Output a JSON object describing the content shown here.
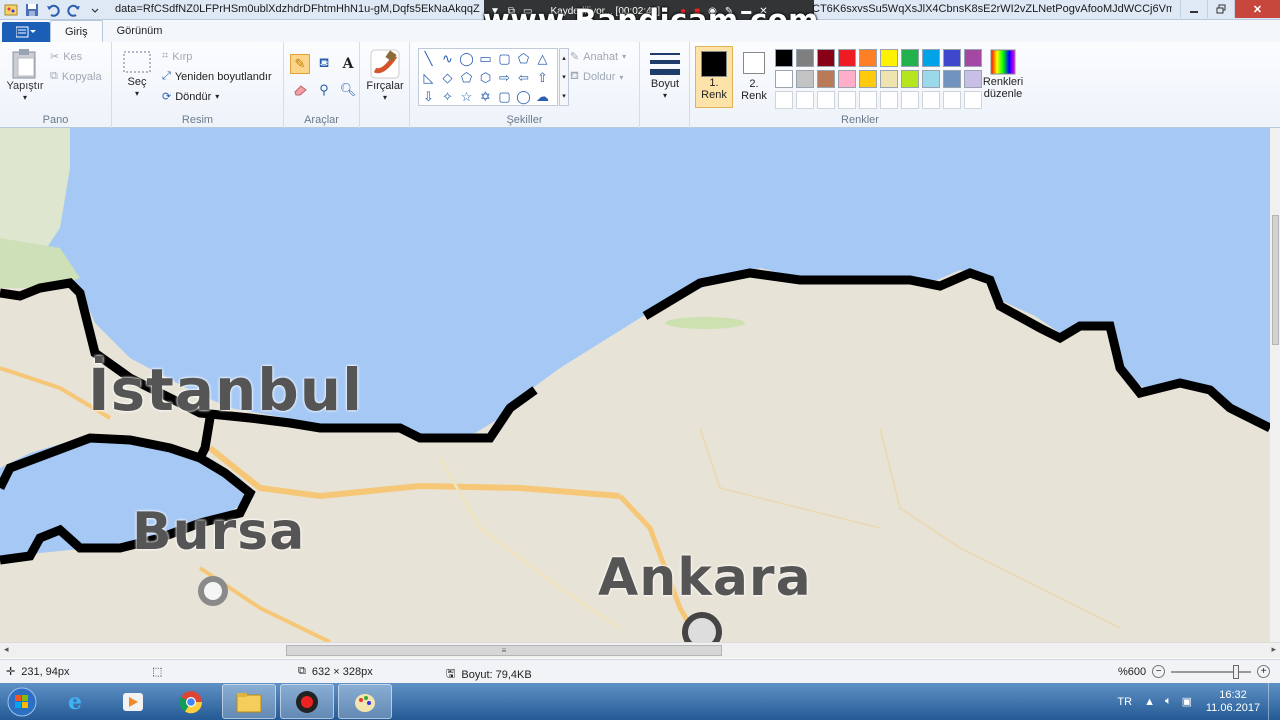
{
  "window": {
    "title_left": "data=RfCSdfNZ0LFPrHSm0ublXdzhdrDFhtmHhN1u-gM,Dqfs5EkNaAkqqZ",
    "title_right": "CT6K6sxvsSu5WqXsJlX4CbnsK8sE2rWI2vZLNetPogvAfooMJdWCCj6Vm..."
  },
  "recorder": {
    "status": "Kaydediliyor... [00:02:46]",
    "watermark": "www.Bandicam.com"
  },
  "tabs": [
    {
      "label": "Giriş",
      "active": true
    },
    {
      "label": "Görünüm",
      "active": false
    }
  ],
  "ribbon": {
    "pano": {
      "label": "Pano",
      "paste": "Yapıştır",
      "cut": "Kes",
      "copy": "Kopyala"
    },
    "resim": {
      "label": "Resim",
      "select": "Seç",
      "crop": "Kırp",
      "resize": "Yeniden boyutlandır",
      "rotate": "Döndür"
    },
    "araclar": {
      "label": "Araçlar"
    },
    "brushes": "Fırçalar",
    "sekiller": {
      "label": "Şekiller",
      "outline": "Anahat",
      "fill": "Doldur"
    },
    "size": "Boyut",
    "color1": {
      "line1": "1.",
      "line2": "Renk"
    },
    "color2": {
      "line1": "2.",
      "line2": "Renk"
    },
    "renkler": {
      "label": "Renkler",
      "edit_line1": "Renkleri",
      "edit_line2": "düzenle",
      "palette_row1": [
        "#000000",
        "#7f7f7f",
        "#880015",
        "#ed1c24",
        "#ff7f27",
        "#fff200",
        "#22b14c",
        "#00a2e8",
        "#3f48cc",
        "#a349a4"
      ],
      "palette_row2": [
        "#ffffff",
        "#c3c3c3",
        "#b97a57",
        "#ffaec9",
        "#ffc90e",
        "#efe4b0",
        "#b5e61d",
        "#99d9ea",
        "#7092be",
        "#c8bfe7"
      ]
    }
  },
  "map": {
    "labels": [
      "İstanbul",
      "Bursa",
      "Ankara"
    ]
  },
  "status": {
    "cursor": "231, 94px",
    "dimensions": "632 × 328px",
    "size": "Boyut: 79,4KB",
    "zoom": "%600"
  },
  "taskbar": {
    "language": "TR",
    "time": "16:32",
    "date": "11.06.2017"
  }
}
